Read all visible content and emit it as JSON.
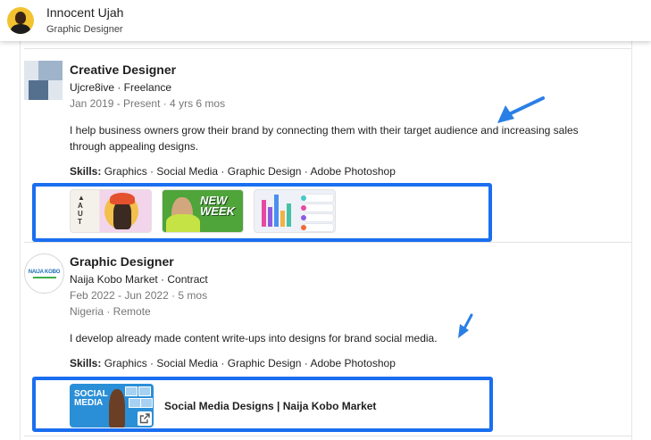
{
  "header": {
    "name": "Innocent Ujah",
    "headline": "Graphic Designer"
  },
  "experience": [
    {
      "title": "Creative Designer",
      "company_line": "Ujcre8ive · Freelance",
      "dates": "Jan 2019 - Present · 4 yrs 6 mos",
      "description": "I help business owners grow their brand by connecting them with their target audience and increasing sales through appealing designs.",
      "skills_label": "Skills:",
      "skills": "Graphics · Social Media · Graphic Design · Adobe Photoshop",
      "thumb1_letters": "▲\nA\nU\nT",
      "thumb2_text": "NEW WEEK"
    },
    {
      "title": "Graphic Designer",
      "company_line": "Naija Kobo Market · Contract",
      "dates": "Feb 2022 - Jun 2022 · 5 mos",
      "location": "Nigeria · Remote",
      "logo_text": "NAIJA KOBO",
      "description": "I develop already made content write-ups into designs for brand social media.",
      "skills_label": "Skills:",
      "skills": "Graphics · Social Media · Graphic Design · Adobe Photoshop",
      "link_thumb_text": "SOCIAL MEDIA",
      "link_label": "Social Media Designs | Naija Kobo Market"
    }
  ],
  "colors": {
    "highlight": "#1a6ef0",
    "arrow": "#2a7fe6"
  },
  "icons": [
    "avatar",
    "company-logo",
    "external-link-icon",
    "annotation-arrow"
  ]
}
